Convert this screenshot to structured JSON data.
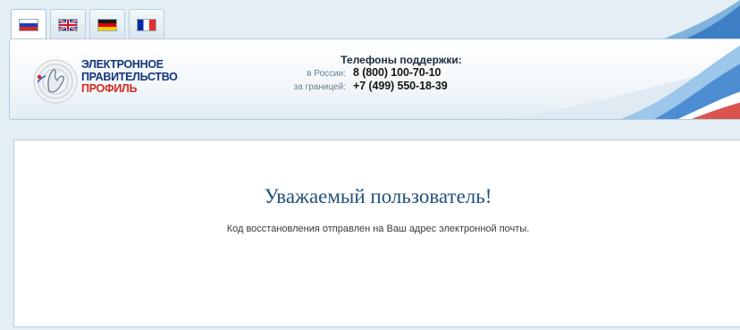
{
  "languages": [
    {
      "code": "ru",
      "flag_icon": "flag-russia-icon",
      "active": true
    },
    {
      "code": "en",
      "flag_icon": "flag-uk-icon",
      "active": false
    },
    {
      "code": "de",
      "flag_icon": "flag-germany-icon",
      "active": false
    },
    {
      "code": "fr",
      "flag_icon": "flag-france-icon",
      "active": false
    }
  ],
  "header": {
    "brand_line1": "ЭЛЕКТРОННОЕ",
    "brand_line2": "ПРАВИТЕЛЬСТВО",
    "brand_line3": "ПРОФИЛЬ",
    "logo_icon": "gosuslugi-hand-logo-icon",
    "support_title": "Телефоны поддержки:",
    "phones": [
      {
        "label": "в России:",
        "number": "8 (800) 100-70-10"
      },
      {
        "label": "за границей:",
        "number": "+7 (499) 550-18-39"
      }
    ]
  },
  "main": {
    "greeting": "Уважаемый пользователь!",
    "message": "Код восстановления отправлен на Ваш адрес электронной почты."
  },
  "colors": {
    "background": "#e4eef5",
    "brand_blue": "#13347b",
    "brand_red": "#d42a20",
    "greeting_blue": "#22517a"
  }
}
